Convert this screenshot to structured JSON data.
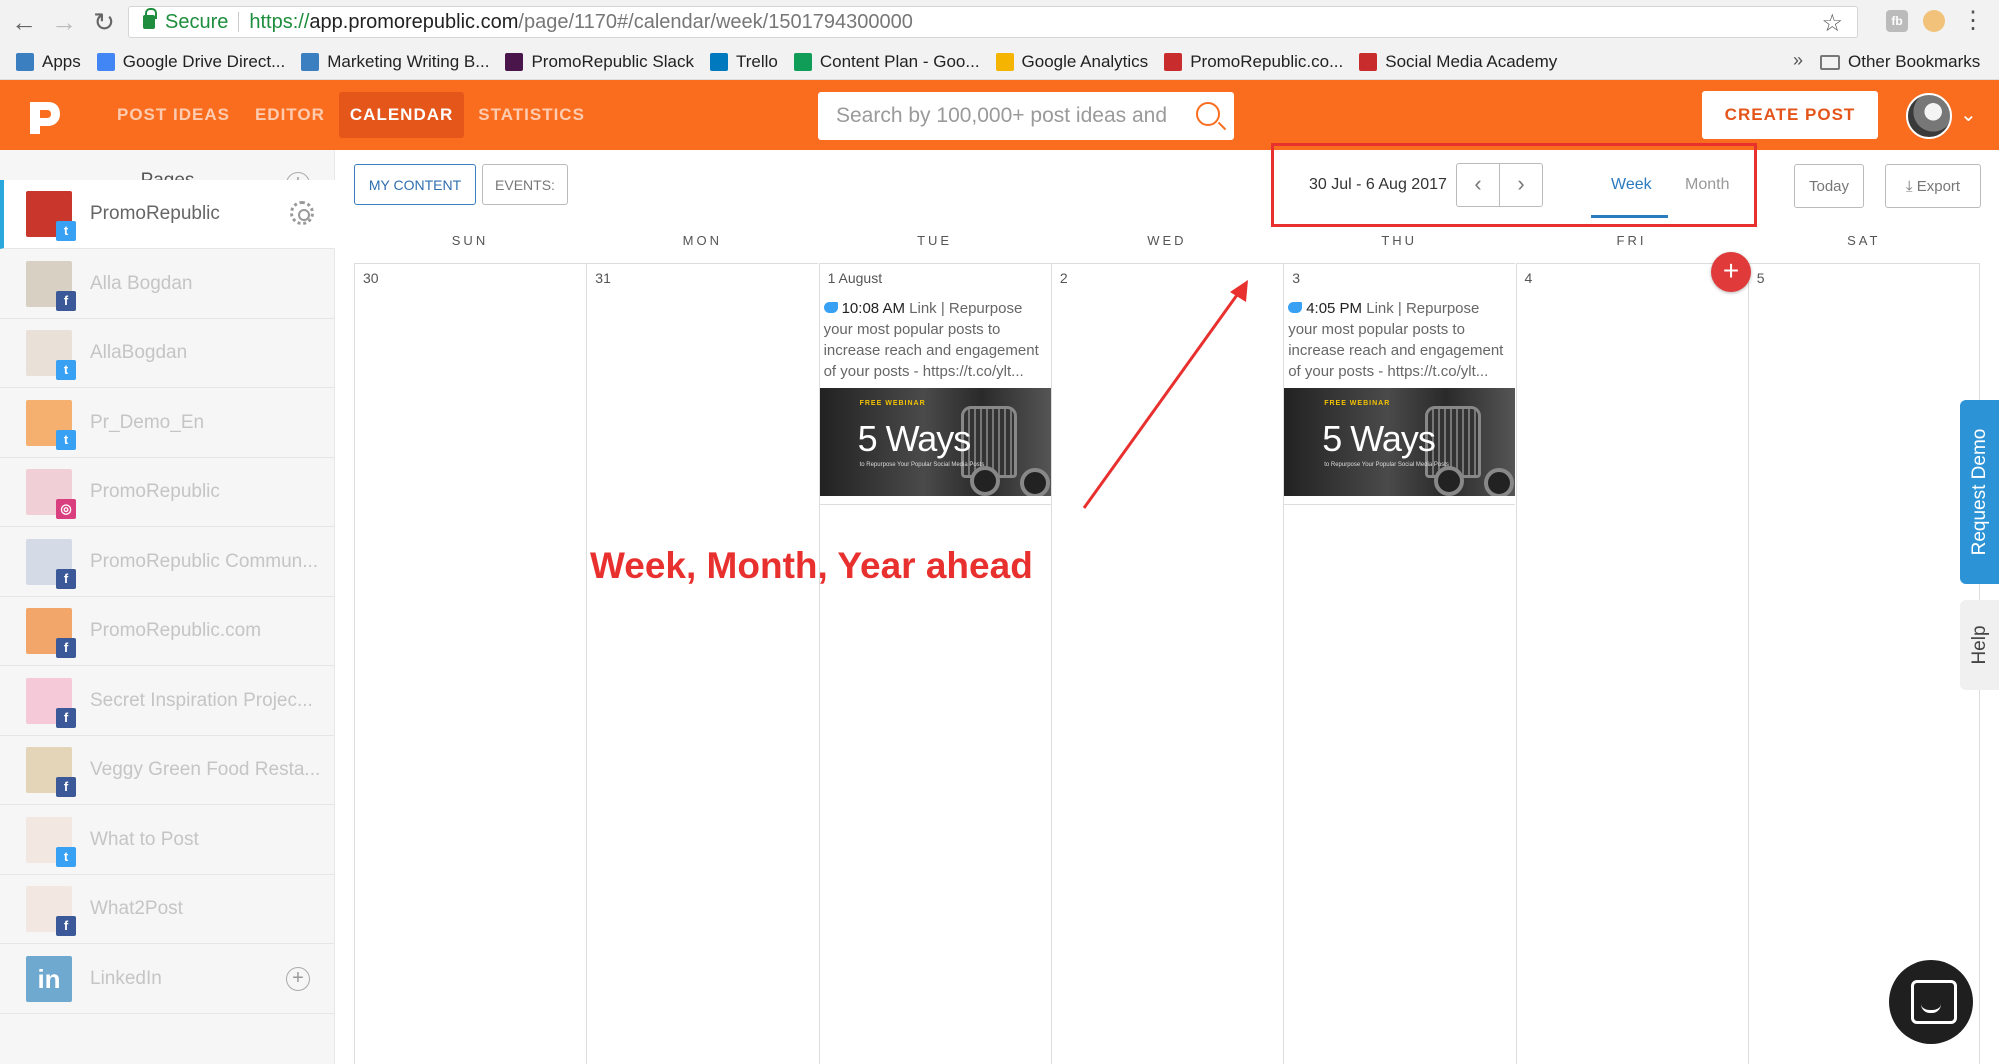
{
  "browser": {
    "secure_label": "Secure",
    "url_scheme": "https://",
    "url_host": "app.promorepublic.com",
    "url_path": "/page/1170#/calendar/week/1501794300000",
    "extension_label": "fb",
    "bookmarks": [
      {
        "label": "Apps",
        "icon_color": "#3b7fc1"
      },
      {
        "label": "Google Drive Direct...",
        "icon_color": "#4285f4"
      },
      {
        "label": "Marketing Writing B...",
        "icon_color": "#3b7fc1"
      },
      {
        "label": "PromoRepublic Slack",
        "icon_color": "#4a154b"
      },
      {
        "label": "Trello",
        "icon_color": "#0079bf"
      },
      {
        "label": "Content Plan - Goo...",
        "icon_color": "#0f9d58"
      },
      {
        "label": "Google Analytics",
        "icon_color": "#f4b400"
      },
      {
        "label": "PromoRepublic.co...",
        "icon_color": "#c92c2c"
      },
      {
        "label": "Social Media Academy",
        "icon_color": "#c92c2c"
      }
    ],
    "chevron": "»",
    "other_bookmarks": "Other Bookmarks"
  },
  "header": {
    "brand_color": "#fa6d1e",
    "nav": [
      {
        "label": "POST IDEAS",
        "active": false
      },
      {
        "label": "EDITOR",
        "active": false
      },
      {
        "label": "CALENDAR",
        "active": true
      },
      {
        "label": "STATISTICS",
        "active": false
      }
    ],
    "search_placeholder": "Search by 100,000+ post ideas and",
    "create_post": "CREATE POST"
  },
  "sidebar": {
    "title": "Pages",
    "plus": "+",
    "pages": [
      {
        "name": "PromoRepublic",
        "network": "twitter",
        "active": true
      },
      {
        "name": "Alla Bogdan",
        "network": "facebook"
      },
      {
        "name": "AllaBogdan",
        "network": "twitter"
      },
      {
        "name": "Pr_Demo_En",
        "network": "twitter"
      },
      {
        "name": "PromoRepublic",
        "network": "instagram"
      },
      {
        "name": "PromoRepublic Commun...",
        "network": "facebook"
      },
      {
        "name": "PromoRepublic.com",
        "network": "facebook"
      },
      {
        "name": "Secret Inspiration Projec...",
        "network": "facebook"
      },
      {
        "name": "Veggy Green Food Resta...",
        "network": "facebook"
      },
      {
        "name": "What to Post",
        "network": "twitter"
      },
      {
        "name": "What2Post",
        "network": "facebook"
      },
      {
        "name": "LinkedIn",
        "network": "linkedin"
      }
    ],
    "linkedin_glyph": "in"
  },
  "toolbar": {
    "my_content": "MY CONTENT",
    "events": "EVENTS:",
    "date_range": "30 Jul - 6 Aug 2017",
    "prev": "‹",
    "next": "›",
    "week": "Week",
    "month": "Month",
    "today": "Today",
    "export": "⤓ Export"
  },
  "calendar": {
    "days": [
      {
        "name": "SUN",
        "date": "30"
      },
      {
        "name": "MON",
        "date": "31"
      },
      {
        "name": "TUE",
        "date": "1 August"
      },
      {
        "name": "WED",
        "date": "2"
      },
      {
        "name": "THU",
        "date": "3"
      },
      {
        "name": "FRI",
        "date": "4"
      },
      {
        "name": "SAT",
        "date": "5"
      }
    ],
    "posts": [
      {
        "time": "10:08 AM",
        "text": " Link | Repurpose your most popular posts to increase reach and engagement of your posts - https://t.co/ylt...",
        "img_webinar": "FREE WEBINAR",
        "img_title": "5 Ways",
        "img_sub": "to Repurpose Your Popular Social Media Posts"
      },
      {
        "time": "4:05 PM",
        "text": " Link | Repurpose your most popular posts to increase reach and engagement of your posts - https://t.co/ylt...",
        "img_webinar": "FREE WEBINAR",
        "img_title": "5 Ways",
        "img_sub": "to Repurpose Your Popular Social Media Posts"
      }
    ],
    "fab": "+"
  },
  "annotation": "Week, Month, Year ahead",
  "annotation_color": "#e8302e",
  "side_tabs": {
    "request_demo": "Request Demo",
    "help": "Help"
  }
}
